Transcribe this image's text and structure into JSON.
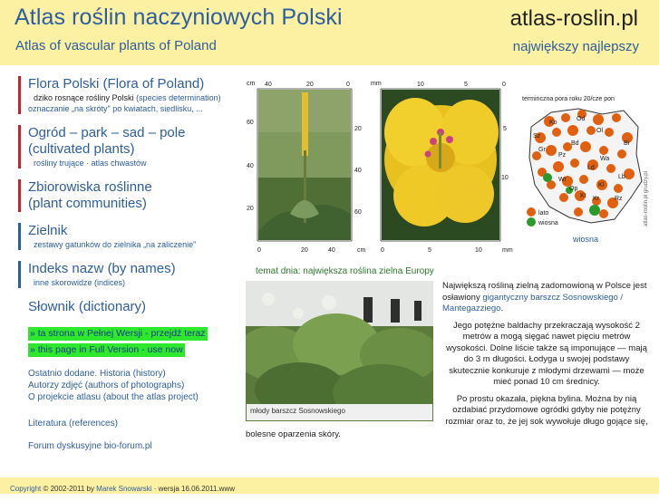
{
  "header": {
    "title": "Atlas roślin naczyniowych Polski",
    "subtitle": "Atlas of vascular plants of Poland",
    "site": "atlas-roslin.pl",
    "slogan": "największy najlepszy"
  },
  "nav": {
    "flora": {
      "title": "Flora Polski",
      "title_en": "(Flora of Poland)",
      "line1": "dziko rosnące rośliny Polski",
      "line1_en": "(species determination)",
      "line2": "oznaczanie „na skróty\" po kwiatach, siedlisku, ..."
    },
    "garden": {
      "title": "Ogród – park – sad – pole",
      "title_en": "(cultivated plants)",
      "sub": "rośliny trujące · atlas chwastów"
    },
    "communities": {
      "title": "Zbiorowiska roślinne",
      "title_en": "(plant communities)"
    },
    "herbarium": {
      "title": "Zielnik",
      "sub": "zestawy gatunków do zielnika „na zaliczenie\""
    },
    "index": {
      "title": "Indeks nazw",
      "title_en": "(by names)",
      "sub": "inne skorowidze (indices)"
    },
    "dictionary": {
      "title": "Słownik",
      "title_en": "(dictionary)"
    },
    "full_pl": "» ta strona w Pełnej Wersji - przejdź teraz",
    "full_en": "» this page in Full Version - use now",
    "recent": "Ostatnio dodane.",
    "history": "Historia (history)",
    "authors": "Autorzy zdjęć (authors of photographs)",
    "about": "O projekcie atlasu (about the atlas project)",
    "literature": "Literatura (references)",
    "forum": "Forum dyskusyjne bio-forum.pl"
  },
  "images": {
    "ruler_left_unit": "cm",
    "ruler_left_top": [
      "40",
      "20",
      "0"
    ],
    "ruler_left_side": [
      "60",
      "40",
      "20"
    ],
    "ruler_left_right": [
      "20",
      "40",
      "60"
    ],
    "ruler_left_bottom": [
      "0",
      "20",
      "40",
      "cm"
    ],
    "ruler_right_unit": "mm",
    "ruler_right_top": [
      "10",
      "5",
      "0"
    ],
    "ruler_right_side": [
      "5",
      "10"
    ],
    "ruler_right_bottom": [
      "0",
      "5",
      "10",
      "mm"
    ],
    "map_title": "terminczna pora roku 20/cze pon",
    "map_side_text": "atlas-roslin.pl grudzy.pl",
    "map_regions": [
      "Ko",
      "Od",
      "Ol",
      "Sz",
      "Bd",
      "Gr",
      "Bi",
      "Pz",
      "Wa",
      "Łd",
      "Lb",
      "Wr",
      "Op",
      "Kl",
      "Kt",
      "Kr",
      "Rz"
    ],
    "legend_late": "lato",
    "legend_spring": "wiosna",
    "map_caption": "wiosna",
    "colors": {
      "late": "#e06010",
      "spring": "#2a9a2a"
    }
  },
  "article": {
    "topic": "temat dnia: największa roślina zielna Europy",
    "photo_caption": "młody barszcz Sosnowskiego",
    "p1_a": "Największą rośliną zielną zadomowioną w Polsce jest osławiony ",
    "p1_link": "gigantyczny barszcz Sosnowskiego / Mantegazziego",
    "p1_b": ".",
    "p2": "Jego potężne baldachy przekraczają wysokość 2 metrów a mogą sięgać nawet pięciu metrów wysokości. Dolne liście także są imponujące — mają do 3 m długości. Łodyga u swojej podstawy skutecznie konkuruje z młodymi drzewami — może mieć ponad 10 cm średnicy.",
    "p3": "Po prostu okazała, piękna bylina. Można by nią ozdabiać przydomowe ogródki gdyby nie potężny rozmiar oraz to, że jej sok wywołuje długo gojące się,",
    "tail": "bolesne oparzenia skóry."
  },
  "footer": {
    "copyright_link": "Copyright",
    "copyright_text": "© 2002-2011 by",
    "author": "Marek Snowarski",
    "version": "· wersja 16.06.2011.www"
  }
}
